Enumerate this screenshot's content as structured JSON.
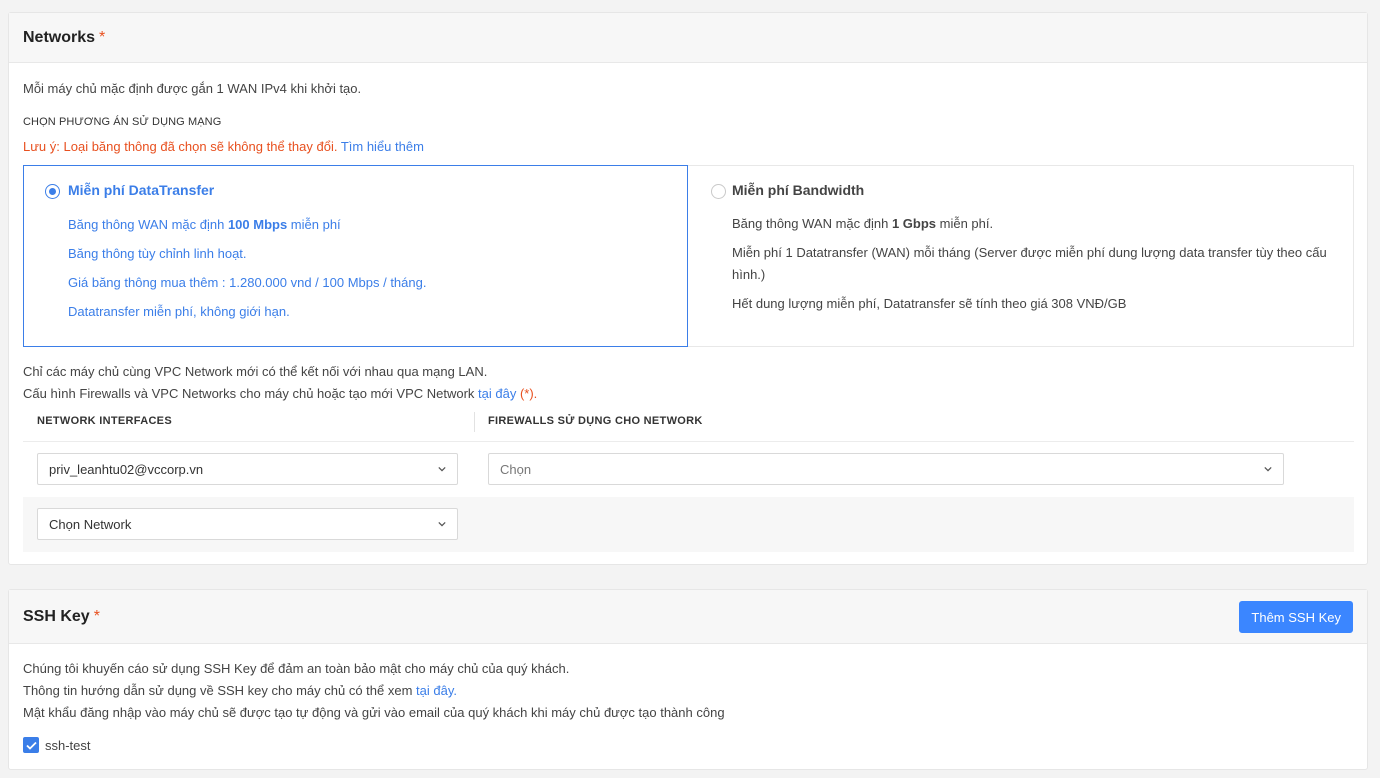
{
  "networks": {
    "title": "Networks",
    "required_mark": "*",
    "intro": "Mỗi máy chủ mặc định được gắn 1 WAN IPv4 khi khởi tạo.",
    "choose_label": "CHỌN PHƯƠNG ÁN SỬ DỤNG MẠNG",
    "warning_text": "Lưu ý: Loại băng thông đã chọn sẽ không thể thay đổi.",
    "learn_more": "Tìm hiểu thêm",
    "option_datatransfer": {
      "title": "Miễn phí DataTransfer",
      "selected": true,
      "line1_prefix": "Băng thông WAN mặc định ",
      "line1_bold": "100 Mbps",
      "line1_suffix": " miễn phí",
      "line2": "Băng thông tùy chỉnh linh hoạt.",
      "line3": "Giá băng thông mua thêm : 1.280.000 vnd / 100 Mbps / tháng.",
      "line4": "Datatransfer miễn phí, không giới hạn."
    },
    "option_bandwidth": {
      "title": "Miễn phí Bandwidth",
      "selected": false,
      "line1_prefix": "Băng thông WAN mặc định ",
      "line1_bold": "1 Gbps",
      "line1_suffix": " miễn phí.",
      "line2a": "Miễn phí 1 Datatransfer (WAN) mỗi tháng (Server được miễn phí dung lượng data transfer tùy theo cấu",
      "line2b": "hình.)",
      "line3": "Hết dung lượng miễn phí, Datatransfer sẽ tính theo giá 308 VNĐ/GB"
    },
    "vpc_note": "Chỉ các máy chủ cùng VPC Network mới có thể kết nối với nhau qua mạng LAN.",
    "config_note_prefix": "Cấu hình Firewalls và VPC Networks cho máy chủ hoặc tạo mới VPC Network ",
    "config_link": "tại đây",
    "config_star": "(*).",
    "col_interfaces": "NETWORK INTERFACES",
    "col_firewalls": "FIREWALLS SỬ DỤNG CHO NETWORK",
    "interface_selected": "priv_leanhtu02@vccorp.vn",
    "firewall_placeholder": "Chọn",
    "network_placeholder": "Chọn Network"
  },
  "ssh": {
    "title": "SSH Key",
    "required_mark": "*",
    "add_button": "Thêm SSH Key",
    "line1": "Chúng tôi khuyến cáo sử dụng SSH Key để đảm an toàn bảo mật cho máy chủ của quý khách.",
    "line2_prefix": "Thông tin hướng dẫn sử dụng về SSH key cho máy chủ có thể xem ",
    "line2_link": "tại đây.",
    "line3": "Mật khẩu đăng nhập vào máy chủ sẽ được tạo tự động và gửi vào email của quý khách khi máy chủ được tạo thành công",
    "keys": [
      {
        "name": "ssh-test",
        "checked": true
      }
    ]
  },
  "colors": {
    "accent": "#3b7ee8",
    "button": "#3b86ff",
    "warning": "#e8501f"
  }
}
